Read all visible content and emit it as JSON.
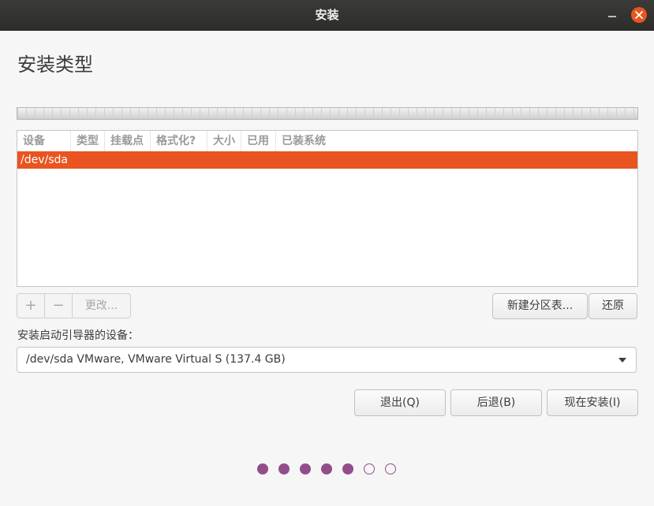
{
  "window": {
    "title": "安装"
  },
  "page": {
    "title": "安装类型"
  },
  "table": {
    "columns": [
      "设备",
      "类型",
      "挂载点",
      "格式化?",
      "大小",
      "已用",
      "已装系统"
    ],
    "rows": [
      {
        "device": "/dev/sda",
        "selected": true
      }
    ]
  },
  "controls": {
    "add_label": "+",
    "remove_label": "−",
    "change_label": "更改...",
    "new_table_label": "新建分区表...",
    "revert_label": "还原"
  },
  "boot": {
    "label": "安装启动引导器的设备：",
    "selected": "/dev/sda VMware, VMware Virtual S (137.4 GB)"
  },
  "buttons": {
    "quit": "退出(Q)",
    "back": "后退(B)",
    "install": "现在安装(I)"
  },
  "progress": {
    "total_steps": 7,
    "completed_steps": 5
  },
  "colors": {
    "accent": "#e95420",
    "step_dot": "#924d8b"
  }
}
